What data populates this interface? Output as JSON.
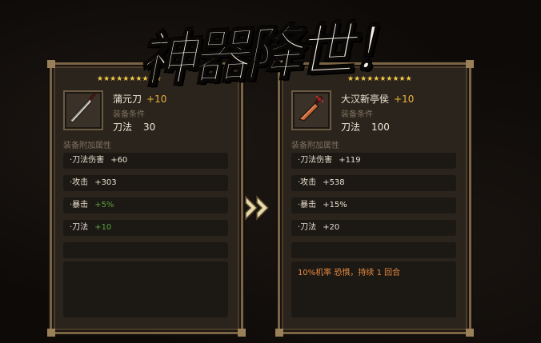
{
  "title": "神器降世！",
  "left_item": {
    "stars": "★★★★★★★★★★",
    "name": "蒲元刀",
    "plus": "+10",
    "req_label": "装备条件",
    "req_skill": "刀法",
    "req_value": "30",
    "attr_title": "装备附加属性",
    "attrs": [
      {
        "label": "·刀法伤害",
        "value": "+60"
      },
      {
        "label": "·攻击",
        "value": "+303"
      },
      {
        "label": "·暴击",
        "value": "+5%"
      },
      {
        "label": "·刀法",
        "value": "+10"
      }
    ]
  },
  "right_item": {
    "stars": "★★★★★★★★★★",
    "name": "大汉新亭侯",
    "plus": "+10",
    "req_label": "装备条件",
    "req_skill": "刀法",
    "req_value": "100",
    "attr_title": "装备附加属性",
    "attrs": [
      {
        "label": "·刀法伤害",
        "value": "+119"
      },
      {
        "label": "·攻击",
        "value": "+538"
      },
      {
        "label": "·暴击",
        "value": "+15%"
      },
      {
        "label": "·刀法",
        "value": "+20"
      }
    ],
    "effect": "10%机率 恐惧，持续 1 回合"
  },
  "colors": {
    "frame": "#7a6446",
    "star": "#f2c84a",
    "plus": "#e9b33a",
    "bonus_green": "#5aa43e",
    "effect_orange": "#e88a3e"
  },
  "icons": {
    "left_item": "broadsword-icon",
    "right_item": "crimson-saber-icon",
    "arrow": "double-chevron-right-icon"
  }
}
